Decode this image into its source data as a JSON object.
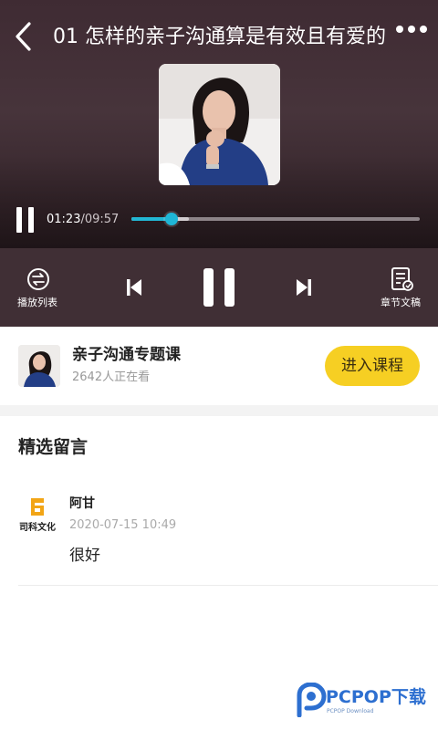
{
  "header": {
    "title": "01 怎样的亲子沟通算是有效且有爱的"
  },
  "player": {
    "current_time": "01:23",
    "separator": "/",
    "total_time": "09:57",
    "progress_fraction": 0.139,
    "buffer_fraction": 0.2,
    "accent_color": "#22b7d4"
  },
  "controls": {
    "playlist_label": "播放列表",
    "transcript_label": "章节文稿"
  },
  "course": {
    "title": "亲子沟通专题课",
    "viewers": "2642人正在看",
    "enter_label": "进入课程",
    "button_color": "#f6cf23"
  },
  "comments": {
    "section_title": "精选留言",
    "items": [
      {
        "author": "阿甘",
        "time": "2020-07-15 10:49",
        "text": "很好",
        "avatar_logo_text": "司科文化"
      }
    ]
  },
  "watermark": {
    "brand": "PCPOP下载",
    "sub": "PCPOP Download"
  }
}
